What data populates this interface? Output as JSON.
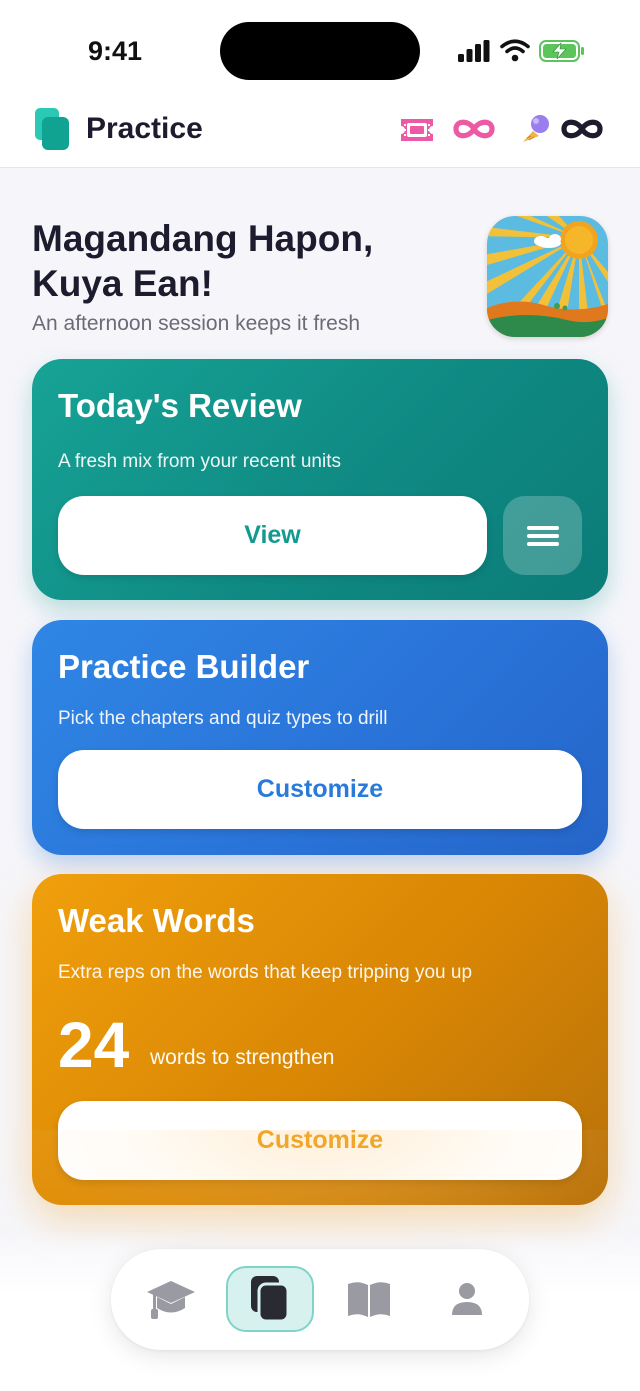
{
  "status_bar": {
    "time": "9:41"
  },
  "header": {
    "title": "Practice",
    "logo_icon": "cards-icon",
    "tickets_value": "∞",
    "treats_value": "∞",
    "colors": {
      "teal": "#17a396",
      "pink": "#ec5aa6"
    }
  },
  "greeting": {
    "line1": "Magandang Hapon,",
    "line2": "Kuya Ean!",
    "subtitle": "An afternoon session keeps it fresh",
    "art_icon": "sun-landscape-icon"
  },
  "cards": {
    "todays_review": {
      "title": "Today's Review",
      "description": "A fresh mix from your recent units",
      "button": "View",
      "menu_icon": "hamburger-menu-icon",
      "color": "#17a396"
    },
    "practice_builder": {
      "title": "Practice Builder",
      "description": "Pick the chapters and quiz types to drill",
      "button": "Customize",
      "color": "#2a7ad9"
    },
    "weak_words": {
      "title": "Weak Words",
      "description": "Extra reps on the words that keep tripping you up",
      "count": "24",
      "count_label": "words to strengthen",
      "button": "Customize",
      "color": "#eb9b0e"
    }
  },
  "tabbar": {
    "active": "practice",
    "tabs": [
      {
        "id": "learn",
        "icon": "graduation-cap-icon"
      },
      {
        "id": "practice",
        "icon": "cards-icon"
      },
      {
        "id": "library",
        "icon": "book-icon"
      },
      {
        "id": "profile",
        "icon": "person-icon"
      }
    ]
  }
}
